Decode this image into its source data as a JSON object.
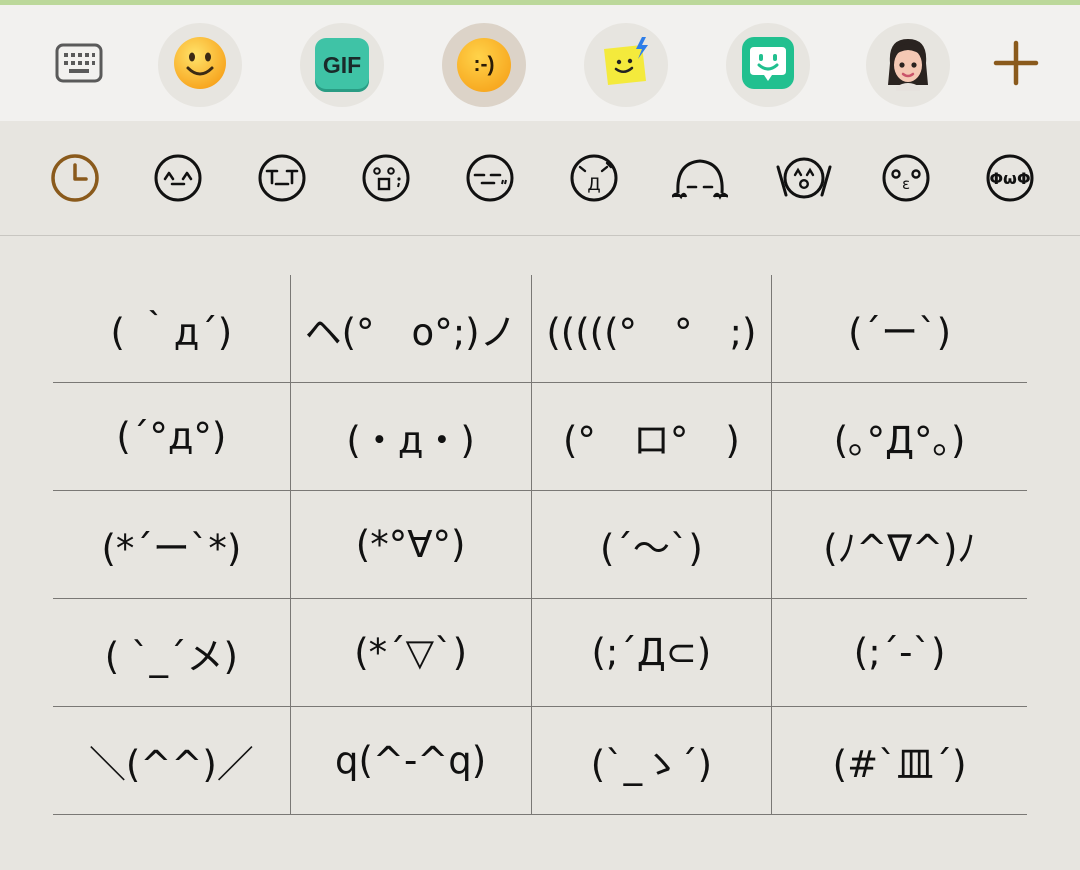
{
  "toolbar": {
    "items": [
      {
        "name": "keyboard",
        "icon": "keyboard-icon"
      },
      {
        "name": "emoji",
        "icon": "smiley-emoji-icon"
      },
      {
        "name": "gif",
        "icon": "gif-icon",
        "label": "GIF"
      },
      {
        "name": "emoticons",
        "icon": "emoticon-icon",
        "label": ":-)",
        "selected": true
      },
      {
        "name": "stickers",
        "icon": "sticker-icon"
      },
      {
        "name": "bitmoji",
        "icon": "bitmoji-icon"
      },
      {
        "name": "avatar",
        "icon": "avatar-icon"
      },
      {
        "name": "add",
        "icon": "plus-icon"
      }
    ],
    "accent": "#8a5a1c"
  },
  "categories": [
    {
      "name": "recent",
      "icon": "clock-icon",
      "label": "",
      "selected": true
    },
    {
      "name": "happy",
      "icon": "face-icon",
      "label": "^_^"
    },
    {
      "name": "sad",
      "icon": "face-icon",
      "label": "T_T"
    },
    {
      "name": "surprised",
      "icon": "face-icon",
      "label": "°□°"
    },
    {
      "name": "annoyed",
      "icon": "face-icon",
      "label": "-_-"
    },
    {
      "name": "angry",
      "icon": "face-icon",
      "label": "Д"
    },
    {
      "name": "peeking",
      "icon": "face-icon",
      "label": "-_-"
    },
    {
      "name": "cheering",
      "icon": "face-icon",
      "label": "^o^"
    },
    {
      "name": "kiss",
      "icon": "face-icon",
      "label": "°ε°"
    },
    {
      "name": "cute",
      "icon": "face-icon",
      "label": "ΦωΦ"
    }
  ],
  "emoticons": [
    [
      "( ｀д´)",
      "ヘ(°　o°;)ノ",
      "(((((°　°　;)",
      "(´ー`)"
    ],
    [
      "(´°д°)",
      "(・д・)",
      "(°　ロ°　)",
      "(｡°Д°｡)"
    ],
    [
      "(*´ー`*)",
      "(*°∀°)",
      "(´～`)",
      "(ﾉ^∇^)ﾉ"
    ],
    [
      "( `_´メ)",
      "(*´▽`)",
      "(;´Д⊂)",
      "(;´-`)"
    ],
    [
      "＼(^^)／",
      "q(^-^q)",
      "(`_ゝ´)",
      "(#`皿´)"
    ]
  ]
}
